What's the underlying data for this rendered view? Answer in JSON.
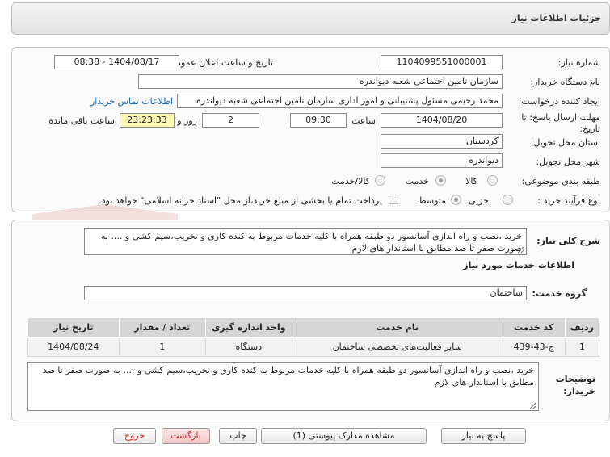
{
  "header": {
    "title": "جزئیات اطلاعات نیاز"
  },
  "need_number": {
    "label": "شماره نیاز:",
    "value": "1104099551000001"
  },
  "announce_date": {
    "label": "تاریخ و ساعت اعلان عمومی:",
    "value": "1404/08/17 - 08:38"
  },
  "buyer_org": {
    "label": "نام دستگاه خریدار:",
    "value": "سازمان تامین اجتماعی شعبه دیواندره"
  },
  "requester": {
    "label": "ایجاد کننده درخواست:",
    "value": "محمد رحیمی مسئول پشتیبانی و امور اداری سازمان تامین اجتماعی شعبه دیواندره",
    "contact_link": "اطلاعات تماس خریدار"
  },
  "deadline": {
    "label": "مهلت ارسال پاسخ: تا تاریخ:",
    "date": "1404/08/20",
    "time_label": "ساعت",
    "time": "09:30",
    "days": "2",
    "days_label": "روز و",
    "remaining": "23:23:33",
    "remaining_label": "ساعت باقی مانده"
  },
  "province": {
    "label": "استان محل تحویل:",
    "value": "کردستان"
  },
  "city": {
    "label": "شهر محل تحویل:",
    "value": "دیواندره"
  },
  "category": {
    "label": "طبقه بندی موضوعی:",
    "options": [
      "کالا",
      "خدمت",
      "کالا/خدمت"
    ],
    "selected": "خدمت"
  },
  "process": {
    "label": "نوع فرآیند خرید :",
    "options": [
      "جزیی",
      "متوسط"
    ],
    "selected": "متوسط",
    "payment_note": "پرداخت تمام یا بخشی از مبلغ خرید،از محل \"اسناد خزانه اسلامی\" خواهد بود."
  },
  "summary": {
    "label": "شرح کلی نیاز:",
    "text": "خرید ،نصب و راه اندازی آسانسور دو طبقه همراه با کلیه خدمات مربوط به کنده کاری و تخریب،سیم کشی و .... به صورت صفر تا صد مطابق با  استاندار های لازم"
  },
  "services_title": "اطلاعات خدمات مورد نیاز",
  "service_group": {
    "label": "گروه خدمت:",
    "value": "ساختمان"
  },
  "table": {
    "headers": [
      "ردیف",
      "کد خدمت",
      "نام خدمت",
      "واحد اندازه گیری",
      "تعداد / مقدار",
      "تاریخ نیاز"
    ],
    "rows": [
      [
        "1",
        "ج-43-439",
        "سایر فعالیت‌های تخصصی ساختمان",
        "دستگاه",
        "1",
        "1404/08/24"
      ]
    ]
  },
  "buyer_notes": {
    "label": "توضیحات خریدار:",
    "text": "خرید ،نصب و راه اندازی آسانسور دو طبقه همراه با کلیه خدمات مربوط به کنده کاری و تخریب،سیم کشی و .... به صورت صفر تا صد مطابق با  استاندار های لازم"
  },
  "buttons": {
    "reply": "پاسخ به نیاز",
    "attachments": "مشاهده مدارک پیوستی (1)",
    "print": "چاپ",
    "back": "بازگشت",
    "exit": "خروج"
  },
  "watermark": "AriaTender.net",
  "colors": {
    "link": "#1565c0",
    "remaining_bg": "#fdf6b2",
    "exit_text": "#c62828"
  }
}
